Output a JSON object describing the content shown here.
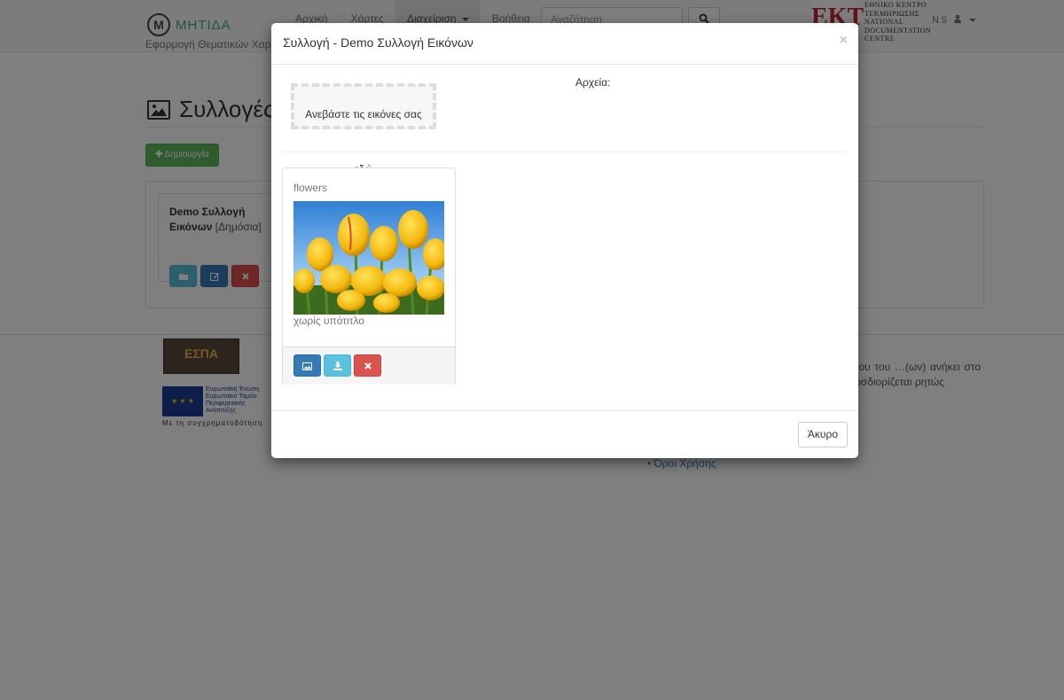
{
  "navbar": {
    "brand_logo": "Μ",
    "brand_name": "ΜΗΤΙΔΑ",
    "brand_subtitle": "Εφαρμογή Θεματικών Χαρτ",
    "items": [
      {
        "label": "Αρχική"
      },
      {
        "label": "Χάρτες"
      },
      {
        "label": "Διαχείριση"
      },
      {
        "label": "Βοήθεια"
      }
    ],
    "search_placeholder": "Αναζήτηση",
    "ekt_logo": "ΕΚΤ",
    "ekt_lines": [
      "ΕΘΝΙΚΟ ΚΕΝΤΡΟ",
      "ΤΕΚΜΗΡΙΩΣΗΣ",
      "NATIONAL",
      "DOCUMENTATION",
      "CENTRE"
    ],
    "user_initials": "NS"
  },
  "page": {
    "title": "Συλλογές",
    "create_label": "Δημιουργία",
    "collection": {
      "name": "Demo Συλλογή Εικόνων",
      "visibility": "[Δημόσια]"
    }
  },
  "footer": {
    "espa_label": "ΕΣΠΑ",
    "eu_lines": [
      "Ευρωπαϊκή Ένωση",
      "Ευρωπαϊκό Ταμείο",
      "Περιφερειακής",
      "Ανάπτυξης"
    ],
    "eu_caption": "Με τη συγχρηματοδότηση",
    "text": "…του διαδικτυακού τόπου …επαφής, κειμένου του …(ων) ανήκει στο ΕΚΤ και … Αναφορά Μη Εμπορική … αν προσδιορίζεται ρητώς",
    "terms_link": "• Όροι Χρήσης"
  },
  "modal": {
    "title": "Συλλογή - Demo Συλλογή Εικόνων",
    "close_glyph": "×",
    "dropzone_text": "Ανεβάστε τις εικόνες σας εδώ",
    "files_label": "Αρχεία:",
    "image": {
      "name": "flowers",
      "caption": "χωρίς υπότιτλο"
    },
    "cancel_label": "Άκυρο"
  },
  "colors": {
    "success": "#5cb85c",
    "info": "#5bc0de",
    "primary": "#337ab7",
    "danger": "#d9534f"
  }
}
